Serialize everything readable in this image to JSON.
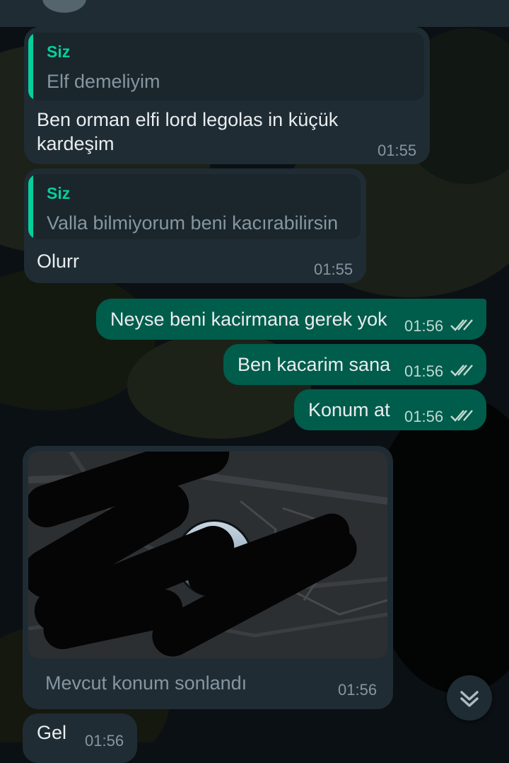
{
  "messages": [
    {
      "direction": "incoming",
      "quote": {
        "author": "Siz",
        "text": "Elf demeliyim"
      },
      "text_lines": [
        "Ben orman elfi lord legolas in küçük",
        "kardeşim"
      ],
      "time": "01:55"
    },
    {
      "direction": "incoming",
      "quote": {
        "author": "Siz",
        "text": "Valla bilmiyorum beni kacırabilirsin"
      },
      "text": "Olurr",
      "time": "01:55"
    },
    {
      "direction": "outgoing",
      "text": "Neyse beni kacirmana gerek yok",
      "time": "01:56",
      "status": "read"
    },
    {
      "direction": "outgoing",
      "text": "Ben kacarim sana",
      "time": "01:56",
      "status": "read"
    },
    {
      "direction": "outgoing",
      "text": "Konum at",
      "time": "01:56",
      "status": "read"
    },
    {
      "direction": "incoming",
      "type": "live-location",
      "caption": "Mevcut konum sonlandı",
      "time": "01:56"
    },
    {
      "direction": "incoming",
      "text": "Gel",
      "time": "01:56"
    }
  ],
  "colors": {
    "incoming_bubble": "#1f2c34",
    "outgoing_bubble": "#005c4b",
    "quote_bar": "#06cf9c",
    "read_ticks": "#c7dbd5"
  },
  "icons": {
    "read_receipt": "double-check-icon",
    "scroll": "chevron-double-down-icon"
  }
}
